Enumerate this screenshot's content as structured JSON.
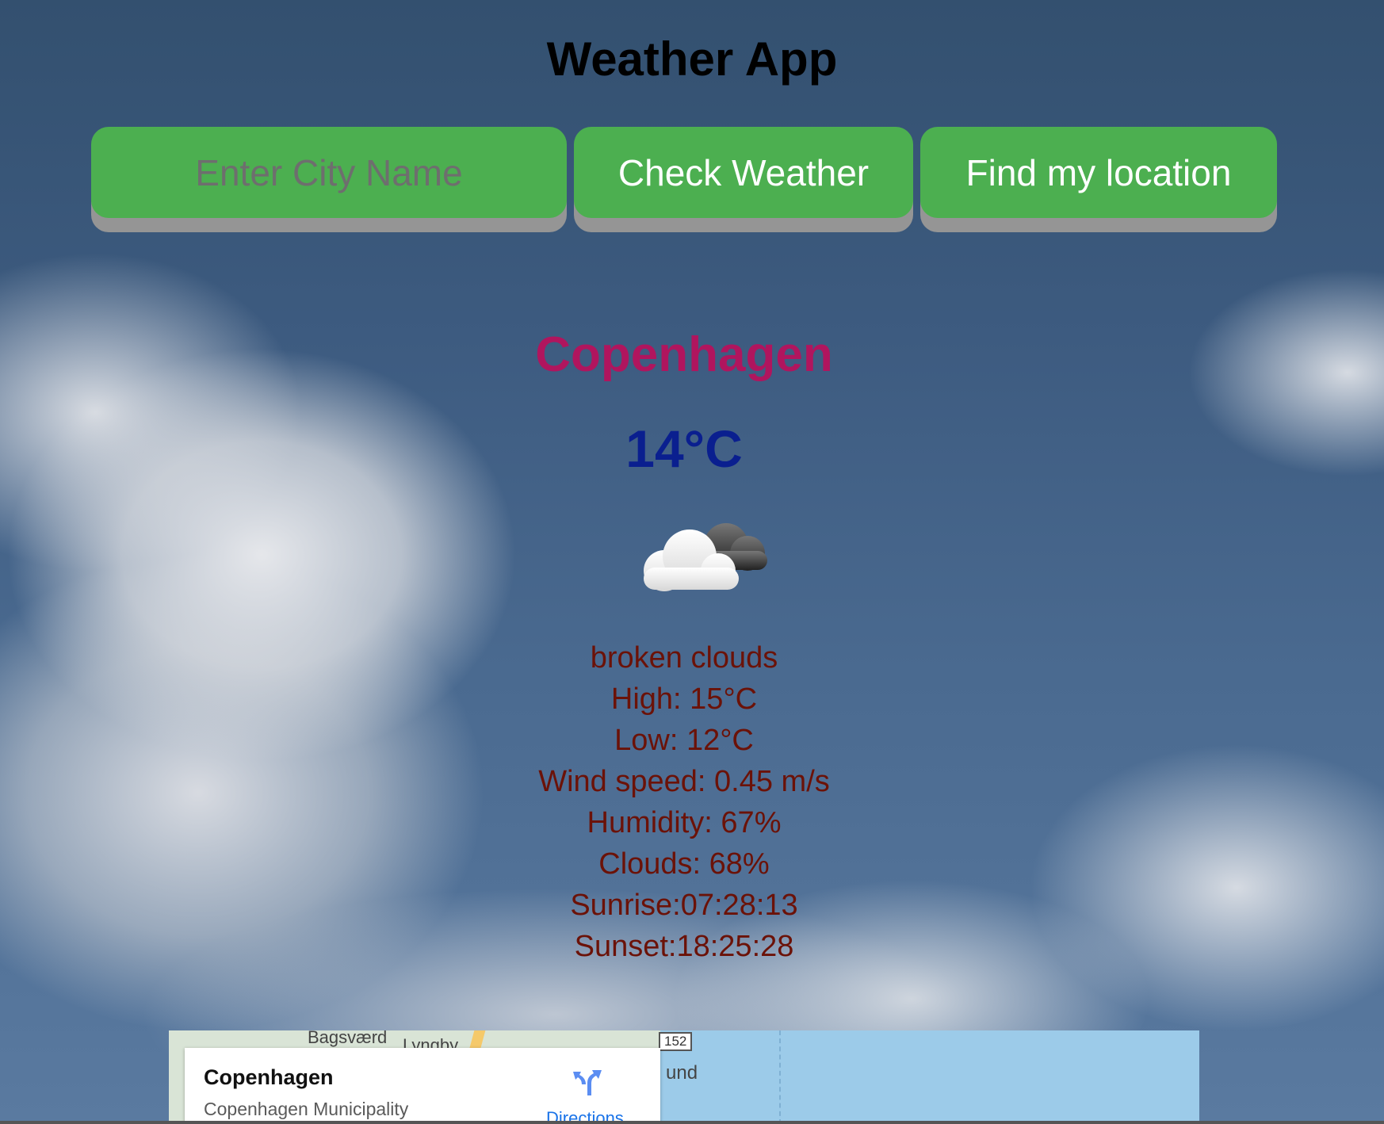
{
  "app": {
    "title": "Weather App"
  },
  "controls": {
    "city_placeholder": "Enter City Name",
    "check_label": "Check Weather",
    "locate_label": "Find my location",
    "button_color": "#4caf50"
  },
  "weather": {
    "city": "Copenhagen",
    "temperature": "14°C",
    "icon": "broken-clouds-icon",
    "description": "broken clouds",
    "high": "High: 15°C",
    "low": "Low: 12°C",
    "wind": "Wind speed: 0.45 m/s",
    "humidity": "Humidity: 67%",
    "clouds": "Clouds: 68%",
    "sunrise": "Sunrise:07:28:13",
    "sunset": "Sunset:18:25:28",
    "city_color": "#b0155e",
    "temperature_color": "#0a1f8f",
    "details_color": "#6b1208"
  },
  "map": {
    "labels": {
      "bagsvaerd": "Bagsværd",
      "lyngby": "Lyngby",
      "und": "und",
      "road": "152"
    },
    "card": {
      "title": "Copenhagen",
      "subtitle": "Copenhagen Municipality",
      "directions": "Directions"
    }
  }
}
